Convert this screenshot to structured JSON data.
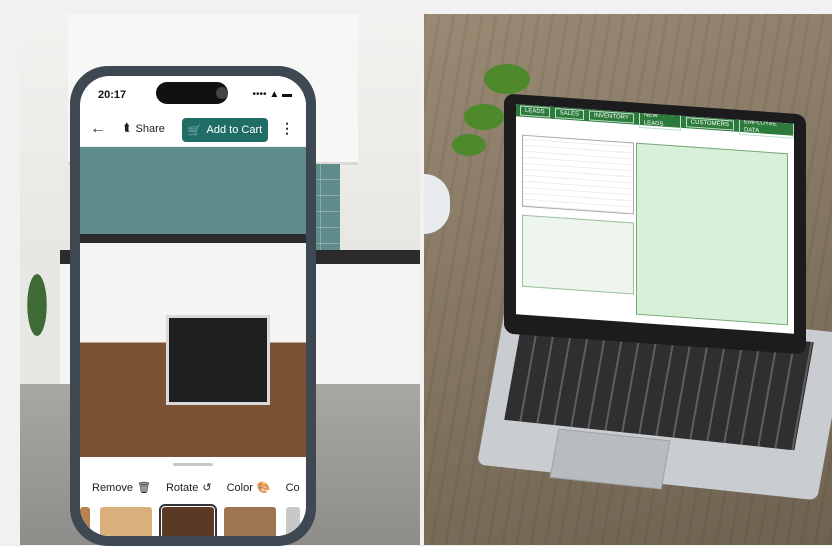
{
  "phone": {
    "status_time": "20:17",
    "status_icons": "•••• ▲ ▬",
    "back_icon": "←",
    "share_label": "Share",
    "share_icon": "⮬",
    "add_to_cart_label": "Add to Cart",
    "cart_icon": "🛒",
    "more_icon": "⋮",
    "actions": {
      "remove": "Remove",
      "remove_icon": "🗑",
      "rotate": "Rotate",
      "rotate_icon": "↺",
      "color": "Color",
      "color_icon": "🎨",
      "partial": "Co"
    },
    "swatch_colors": [
      "#b5834f",
      "#d9b07c",
      "#5a3a24",
      "#9d7550",
      "#c8c8c8"
    ],
    "accent": "#1f6d64"
  },
  "laptop_app": {
    "tabs": [
      "LEADS",
      "SALES",
      "INVENTORY",
      "NEW LEADS",
      "CUSTOMERS",
      "EMPLOYEE DATA"
    ],
    "accent": "#2c7a3c"
  }
}
